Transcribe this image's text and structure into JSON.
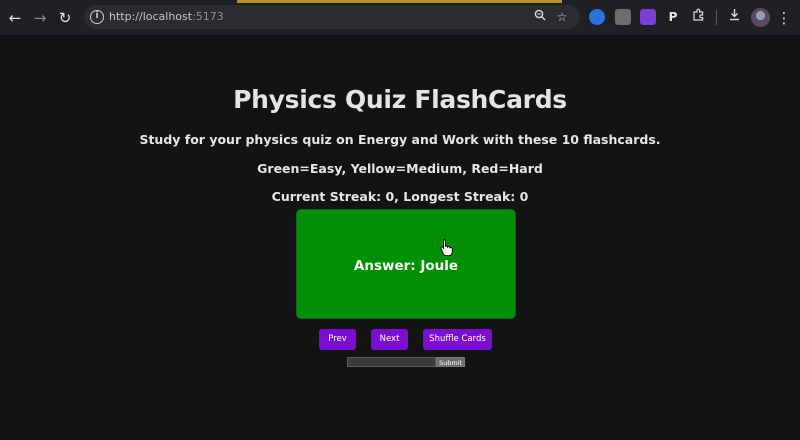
{
  "browser": {
    "url_host": "http://localhost",
    "url_port": ":5173",
    "icons": {
      "back": "arrow-left-icon",
      "forward": "arrow-right-icon",
      "reload": "reload-icon",
      "site_info": "info-icon",
      "zoom": "zoom-icon",
      "bookmark": "star-icon",
      "extensions": "puzzle-icon",
      "downloads": "download-icon",
      "menu": "kebab-menu-icon"
    },
    "extension_letters": [
      "",
      "",
      "",
      "P"
    ]
  },
  "page": {
    "title": "Physics Quiz FlashCards",
    "description": "Study for your physics quiz on Energy and Work with these 10 flashcards.",
    "legend": "Green=Easy, Yellow=Medium, Red=Hard",
    "streak": "Current Streak: 0, Longest Streak: 0",
    "card": {
      "text": "Answer: Joule",
      "difficulty_color": "#049004"
    },
    "buttons": {
      "prev": "Prev",
      "next": "Next",
      "shuffle": "Shuffle Cards"
    },
    "answer_form": {
      "input_value": "",
      "submit": "Submit"
    },
    "colors": {
      "background": "#131215",
      "button": "#7a0fd1",
      "card_easy": "#049004"
    }
  }
}
